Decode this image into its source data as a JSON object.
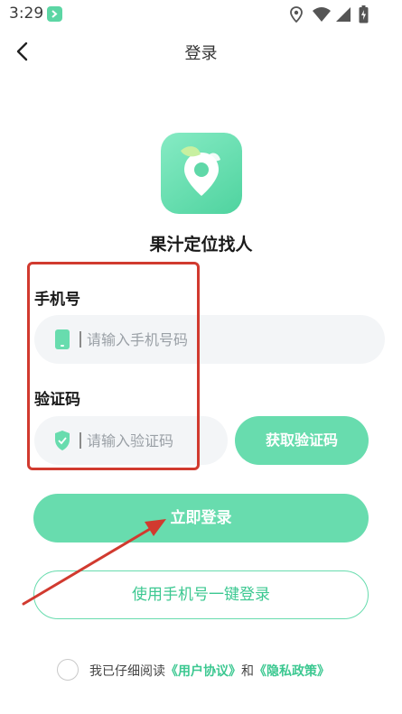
{
  "status_bar": {
    "time": "3:29",
    "app_notification_icon": "app-mini-icon",
    "icons": [
      "location-icon",
      "wifi-icon",
      "signal-icon",
      "battery-icon"
    ]
  },
  "header": {
    "back_icon": "chevron-left-icon",
    "title": "登录"
  },
  "app": {
    "name": "果汁定位找人",
    "logo_icon": "location-pin-leaf-icon",
    "brand_color": "#68dcae"
  },
  "form": {
    "phone_label": "手机号",
    "phone_placeholder": "请输入手机号码",
    "phone_value": "",
    "phone_icon": "phone-icon",
    "code_label": "验证码",
    "code_placeholder": "请输入验证码",
    "code_value": "",
    "code_icon": "shield-check-icon",
    "get_code_button": "获取验证码"
  },
  "actions": {
    "login_button": "立即登录",
    "one_click_login_button": "使用手机号一键登录"
  },
  "agreement": {
    "checked": false,
    "prefix": "我已仔细阅读",
    "user_agreement": "《用户协议》",
    "conjunction": "和",
    "privacy_policy": "《隐私政策》"
  },
  "annotations": {
    "highlight_color": "#d13a2f",
    "arrow_color": "#d13a2f"
  }
}
